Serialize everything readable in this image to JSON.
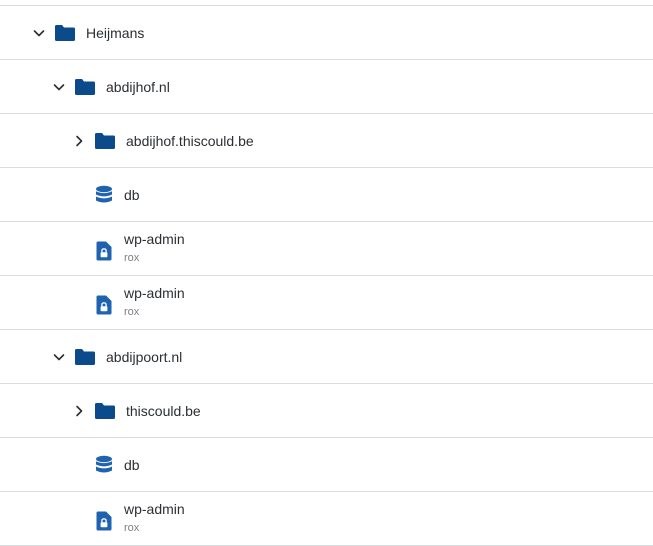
{
  "colors": {
    "folder": "#0b4a8b",
    "icon_blue": "#1f63b0",
    "divider": "#d9dcdf",
    "text": "#2b2f33",
    "subtext": "#7b8087"
  },
  "tree": {
    "heijmans": {
      "label": "Heijmans",
      "icon": "folder-icon",
      "expanded": true
    },
    "abdijhof": {
      "label": "abdijhof.nl",
      "icon": "folder-icon",
      "expanded": true
    },
    "abdijhof_thiscould": {
      "label": "abdijhof.thiscould.be",
      "icon": "folder-icon",
      "expanded": false
    },
    "abdijhof_db": {
      "label": "db",
      "icon": "database-icon"
    },
    "abdijhof_wpadmin_1": {
      "label": "wp-admin",
      "user": "rox",
      "icon": "lock-file-icon"
    },
    "abdijhof_wpadmin_2": {
      "label": "wp-admin",
      "user": "rox",
      "icon": "lock-file-icon"
    },
    "abdijpoort": {
      "label": "abdijpoort.nl",
      "icon": "folder-icon",
      "expanded": true
    },
    "abdijpoort_thiscould": {
      "label": "thiscould.be",
      "icon": "folder-icon",
      "expanded": false
    },
    "abdijpoort_db": {
      "label": "db",
      "icon": "database-icon"
    },
    "abdijpoort_wpadmin": {
      "label": "wp-admin",
      "user": "rox",
      "icon": "lock-file-icon"
    }
  }
}
